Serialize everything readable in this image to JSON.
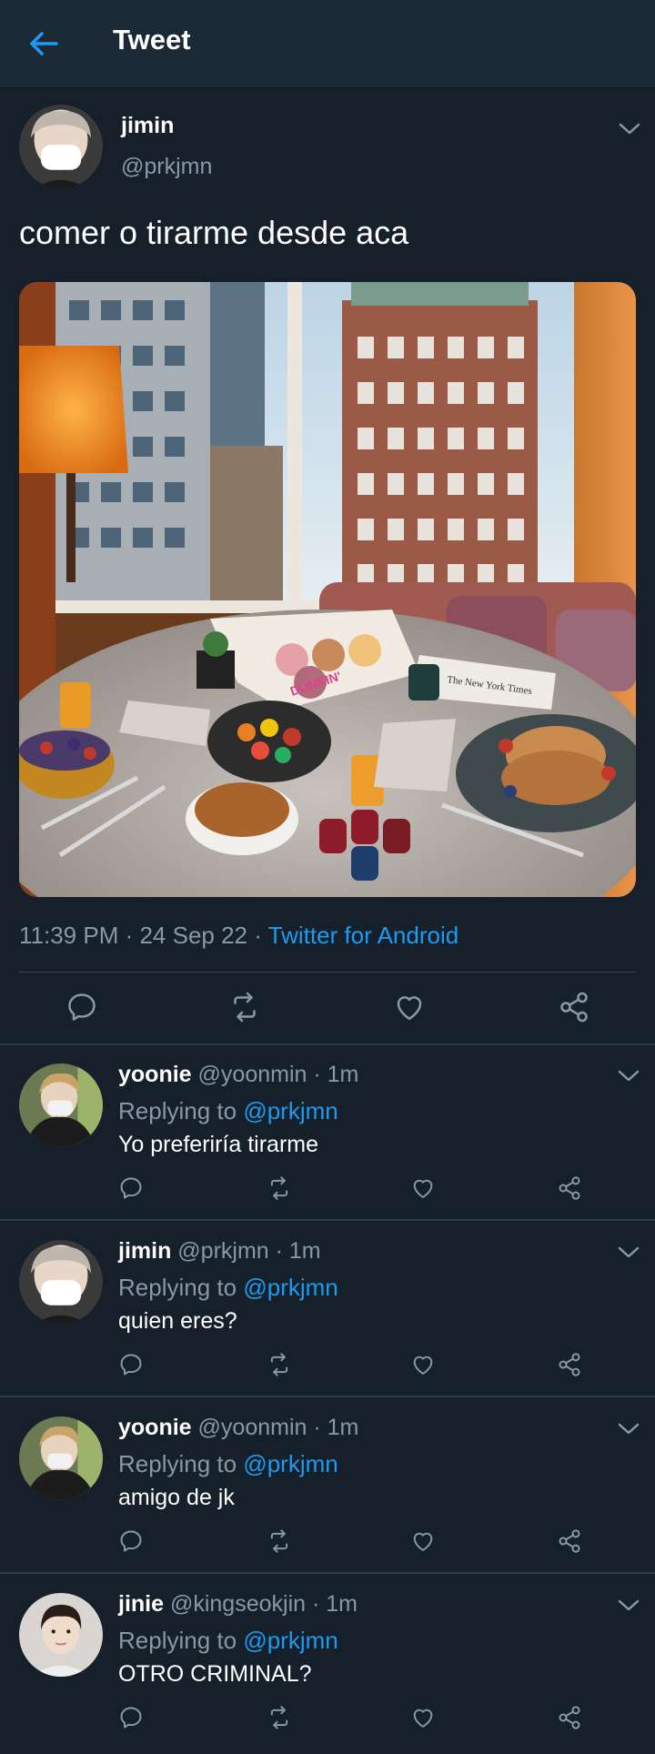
{
  "header": {
    "title": "Tweet"
  },
  "main": {
    "name": "jimin",
    "handle": "@prkjmn",
    "text": "comer o tirarme desde aca",
    "time": "11:39 PM · 24 Sep 22 · ",
    "source": "Twitter for Android",
    "photo_text": {
      "box": "DUNKIN'",
      "paper": "The New York Times"
    }
  },
  "replies": [
    {
      "name": "yoonie",
      "handle": "@yoonmin · 1m",
      "replying_label": "Replying to ",
      "mention": "@prkjmn",
      "text": "Yo preferiría tirarme"
    },
    {
      "name": "jimin",
      "handle": "@prkjmn · 1m",
      "replying_label": "Replying to ",
      "mention": "@prkjmn",
      "text": "quien eres?"
    },
    {
      "name": "yoonie",
      "handle": "@yoonmin · 1m",
      "replying_label": "Replying to ",
      "mention": "@prkjmn",
      "text": "amigo de jk"
    },
    {
      "name": "jinie",
      "handle": "@kingseokjin · 1m",
      "replying_label": "Replying to ",
      "mention": "@prkjmn",
      "text": "OTRO CRIMINAL?"
    }
  ],
  "icons": [
    "back-arrow-icon",
    "chevron-down-icon",
    "reply-icon",
    "retweet-icon",
    "like-icon",
    "share-icon"
  ],
  "colors": {
    "background": "#15202b",
    "accent": "#1d9bf0",
    "secondary_text": "#8899a6"
  }
}
